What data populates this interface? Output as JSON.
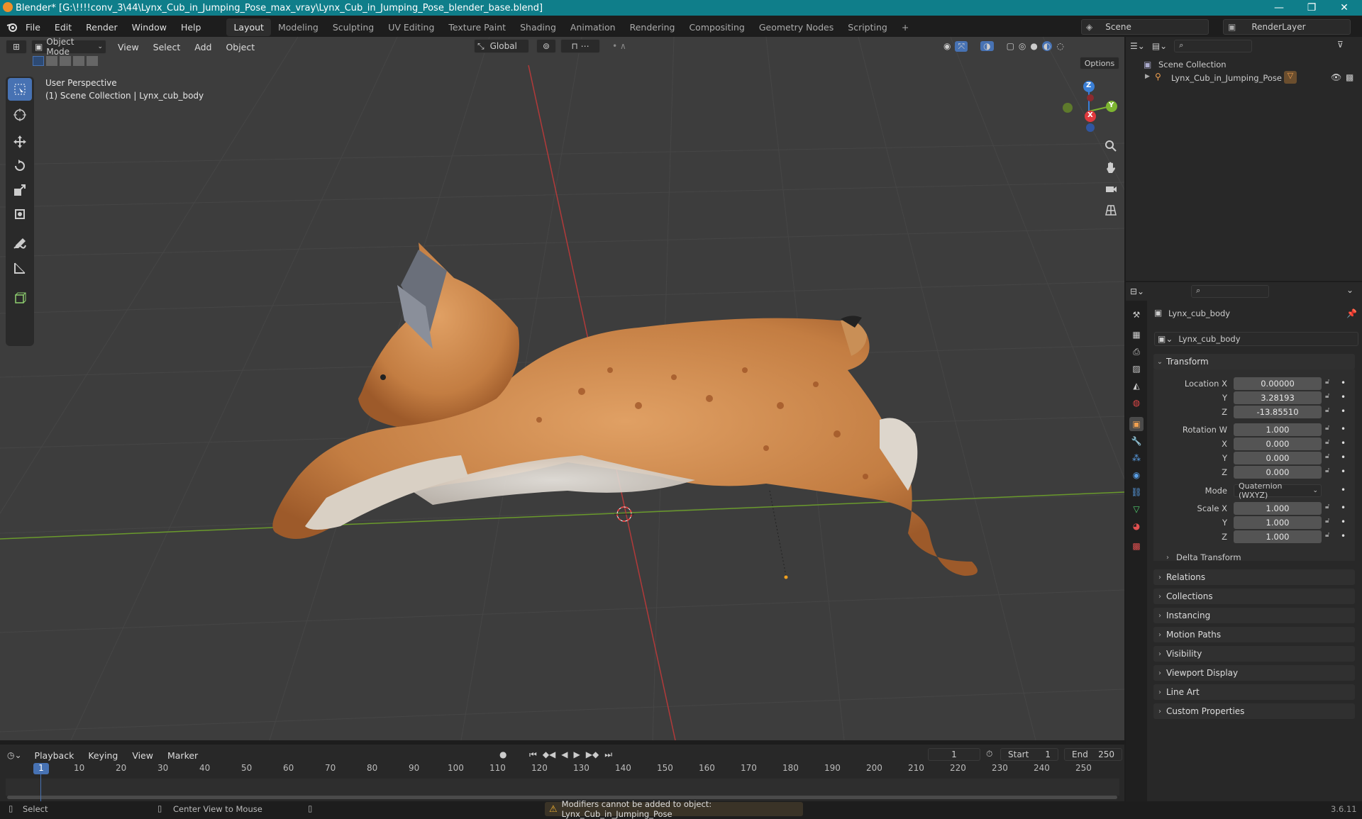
{
  "window": {
    "title": "Blender* [G:\\!!!!conv_3\\44\\Lynx_Cub_in_Jumping_Pose_max_vray\\Lynx_Cub_in_Jumping_Pose_blender_base.blend]",
    "minimize": "—",
    "maximize": "❐",
    "close": "✕"
  },
  "menu": [
    "File",
    "Edit",
    "Render",
    "Window",
    "Help"
  ],
  "workspaces": [
    "Layout",
    "Modeling",
    "Sculpting",
    "UV Editing",
    "Texture Paint",
    "Shading",
    "Animation",
    "Rendering",
    "Compositing",
    "Geometry Nodes",
    "Scripting"
  ],
  "workspace_add": "+",
  "scene": {
    "label": "Scene",
    "render_layer": "RenderLayer"
  },
  "viewport": {
    "mode": "Object Mode",
    "menus": [
      "View",
      "Select",
      "Add",
      "Object"
    ],
    "orientation": "Global",
    "options": "Options",
    "overlay_title": "User Perspective",
    "overlay_sub": "(1) Scene Collection | Lynx_cub_body",
    "axes": {
      "x": "X",
      "y": "Y",
      "z": "Z"
    }
  },
  "outliner": {
    "root": "Scene Collection",
    "item": "Lynx_Cub_in_Jumping_Pose"
  },
  "properties": {
    "object_name": "Lynx_cub_body",
    "data_name": "Lynx_cub_body",
    "transform_title": "Transform",
    "location": {
      "label": "Location X",
      "x": "0.00000",
      "y": "3.28193",
      "z": "-13.85510"
    },
    "rotation": {
      "label": "Rotation W",
      "w": "1.000",
      "x": "0.000",
      "y": "0.000",
      "z": "0.000"
    },
    "axis_labels": {
      "x": "X",
      "y": "Y",
      "z": "Z"
    },
    "mode_label": "Mode",
    "mode_value": "Quaternion (WXYZ)",
    "scale": {
      "label": "Scale X",
      "x": "1.000",
      "y": "1.000",
      "z": "1.000"
    },
    "delta": "Delta Transform",
    "panels": [
      "Relations",
      "Collections",
      "Instancing",
      "Motion Paths",
      "Visibility",
      "Viewport Display",
      "Line Art",
      "Custom Properties"
    ]
  },
  "timeline": {
    "menus": [
      "Playback",
      "Keying",
      "View",
      "Marker"
    ],
    "current_frame": "1",
    "start_label": "Start",
    "start": "1",
    "end_label": "End",
    "end": "250",
    "ticks": [
      "1",
      "10",
      "20",
      "30",
      "40",
      "50",
      "60",
      "70",
      "80",
      "90",
      "100",
      "110",
      "120",
      "130",
      "140",
      "150",
      "160",
      "170",
      "180",
      "190",
      "200",
      "210",
      "220",
      "230",
      "240",
      "250"
    ]
  },
  "status": {
    "select": "Select",
    "center": "Center View to Mouse",
    "warning": "Modifiers cannot be added to object: Lynx_Cub_in_Jumping_Pose",
    "version": "3.6.11"
  },
  "colors": {
    "titlebar": "#0f7e8a",
    "accent": "#4772b3",
    "x_axis": "#e0393d",
    "y_axis": "#7db531",
    "z_axis": "#3a7fd6",
    "lynx": "#c8864a"
  }
}
